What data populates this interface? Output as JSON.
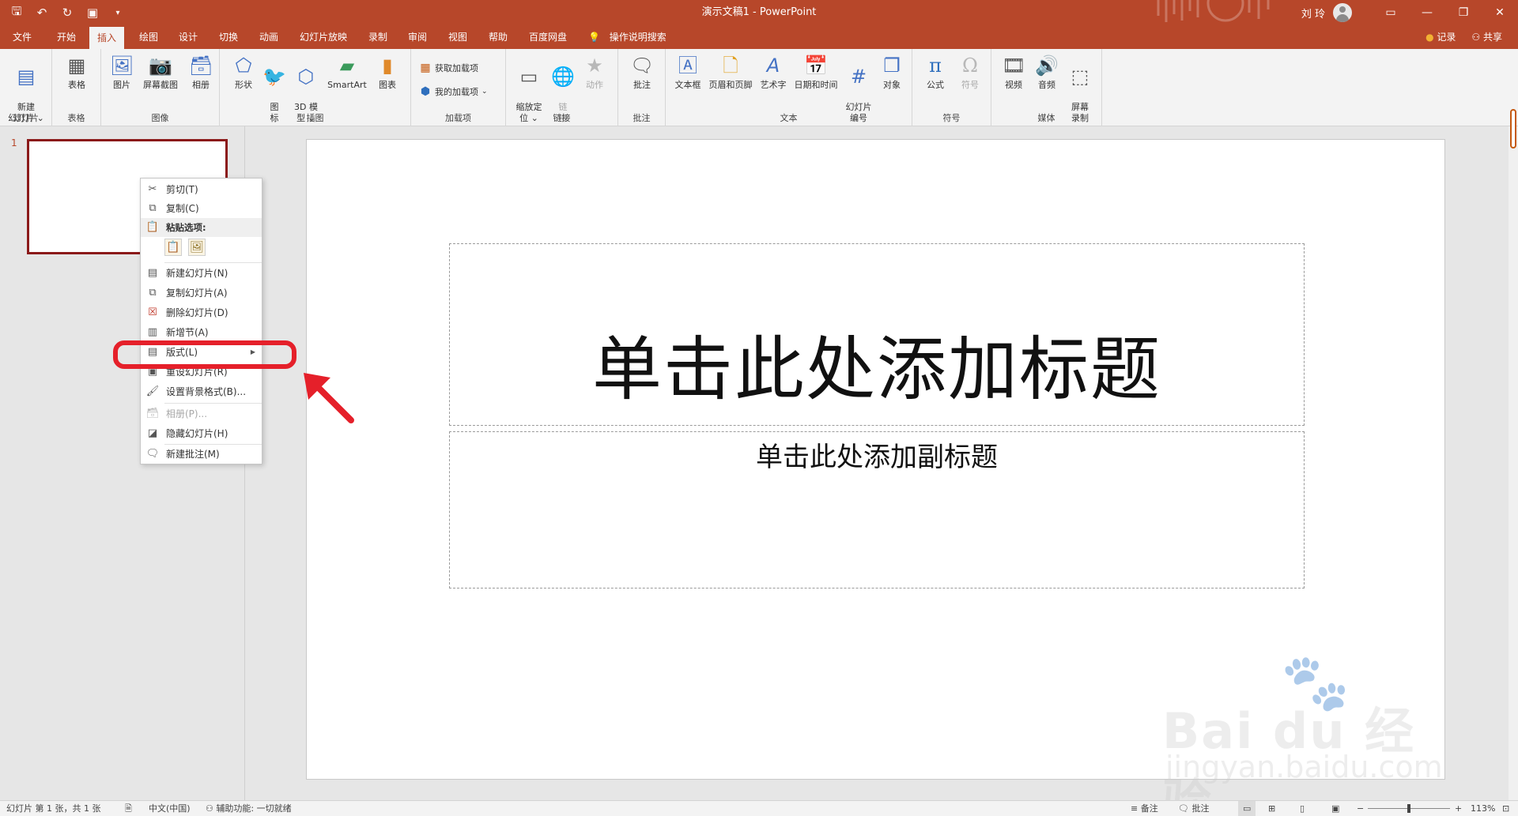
{
  "window": {
    "title": "演示文稿1 - PowerPoint",
    "user_name": "刘 玲",
    "qat_icons": [
      "save-icon",
      "undo-icon",
      "redo-icon",
      "start-from-beginning-icon",
      "customize-qat-icon"
    ],
    "controls": [
      "ribbon-display-icon",
      "minimize-icon",
      "restore-icon",
      "close-icon"
    ]
  },
  "tabs": [
    {
      "label": "文件"
    },
    {
      "label": "开始"
    },
    {
      "label": "插入"
    },
    {
      "label": "绘图"
    },
    {
      "label": "设计"
    },
    {
      "label": "切换"
    },
    {
      "label": "动画"
    },
    {
      "label": "幻灯片放映"
    },
    {
      "label": "录制"
    },
    {
      "label": "审阅"
    },
    {
      "label": "视图"
    },
    {
      "label": "帮助"
    },
    {
      "label": "百度网盘"
    }
  ],
  "tell_me": "操作说明搜索",
  "record_label": "记录",
  "share_label": "共享",
  "ribbon": {
    "groups": {
      "slides": "幻灯片",
      "tables": "表格",
      "images": "图像",
      "illustrations": "插图",
      "addins": "加载项",
      "links": "链接",
      "comments": "批注",
      "text": "文本",
      "symbols": "符号",
      "media": "媒体"
    },
    "buttons": {
      "new_slide": "新建\n幻灯片 ⌄",
      "table": "表格",
      "pictures": "图片",
      "screenshot": "屏幕截图",
      "album": "相册",
      "shapes": "形状",
      "icons": "图\n标",
      "model3d": "3D 模\n型 ⌄",
      "smartart": "SmartArt",
      "chart": "图表",
      "get_addins": "获取加载项",
      "my_addins": "我的加载项",
      "zoom": "缩放定\n位 ⌄",
      "link": "链\n接",
      "action": "动作",
      "comment": "批注",
      "textbox": "文本框",
      "header_footer": "页眉和页脚",
      "wordart": "艺术字",
      "datetime": "日期和时间",
      "slide_number": "幻灯片\n编号",
      "object": "对象",
      "equation": "公式",
      "symbol": "符号",
      "video": "视频",
      "audio": "音频",
      "screen_recording": "屏幕\n录制"
    }
  },
  "thumbnail": {
    "number": "1"
  },
  "slide": {
    "title_placeholder": "单击此处添加标题",
    "subtitle_placeholder": "单击此处添加副标题"
  },
  "context_menu": {
    "items": [
      {
        "label": "剪切(T)",
        "icon": "cut-icon",
        "enabled": true
      },
      {
        "label": "复制(C)",
        "icon": "copy-icon",
        "enabled": true
      },
      {
        "label": "粘贴选项:",
        "icon": "paste-icon",
        "enabled": true
      },
      {
        "label": "新建幻灯片(N)",
        "icon": "new-slide-icon",
        "enabled": true
      },
      {
        "label": "复制幻灯片(A)",
        "icon": "duplicate-slide-icon",
        "enabled": true
      },
      {
        "label": "删除幻灯片(D)",
        "icon": "delete-slide-icon",
        "enabled": true
      },
      {
        "label": "新增节(A)",
        "icon": "add-section-icon",
        "enabled": true
      },
      {
        "label": "版式(L)",
        "icon": "layout-icon",
        "enabled": true
      },
      {
        "label": "重设幻灯片(R)",
        "icon": "reset-slide-icon",
        "enabled": true
      },
      {
        "label": "设置背景格式(B)...",
        "icon": "format-background-icon",
        "enabled": true
      },
      {
        "label": "相册(P)...",
        "icon": "photo-album-icon",
        "enabled": false
      },
      {
        "label": "隐藏幻灯片(H)",
        "icon": "hide-slide-icon",
        "enabled": true
      },
      {
        "label": "新建批注(M)",
        "icon": "new-comment-icon",
        "enabled": true
      }
    ]
  },
  "watermark": {
    "logo_text": "Bai du 经验",
    "url_text": "jingyan.baidu.com"
  },
  "status": {
    "slide_info": "幻灯片 第 1 张，共 1 张",
    "language": "中文(中国)",
    "accessibility": "辅助功能: 一切就绪",
    "notes": "备注",
    "comments": "批注",
    "zoom": "113%"
  },
  "colors": {
    "accent": "#b7472a",
    "highlight": "#e5202a",
    "thumb_border": "#8b1a1a"
  }
}
